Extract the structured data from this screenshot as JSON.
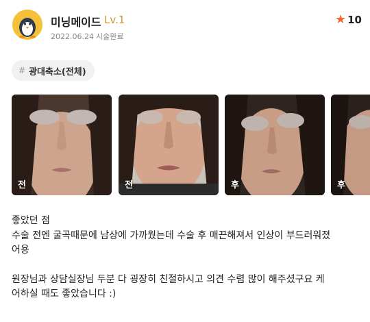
{
  "author": {
    "name": "미닝메이드",
    "level": "Lv.1",
    "date": "2022.06.24",
    "status": "시술완료",
    "avatar_icon": "penguin-icon"
  },
  "rating": {
    "icon": "star-icon",
    "score": "10",
    "color": "#f26a2e"
  },
  "tag": {
    "symbol": "#",
    "label": "광대축소(전체)"
  },
  "photos": [
    {
      "label": "전"
    },
    {
      "label": "전"
    },
    {
      "label": "후"
    },
    {
      "label": "후"
    }
  ],
  "review": {
    "heading": "좋았던 점",
    "paragraph1_line1": "수술 전엔 굴곡때문에 남상에 가까웠는데 수술 후 매끈해져서 인상이 부드러워졌",
    "paragraph1_line2": "어용",
    "paragraph2_line1": "원장님과 상담실장님 두분 다 굉장히 친절하시고 의견 수렴 많이 해주셨구요 케",
    "paragraph2_line2": "어하실 때도 좋았습니다 :)"
  }
}
